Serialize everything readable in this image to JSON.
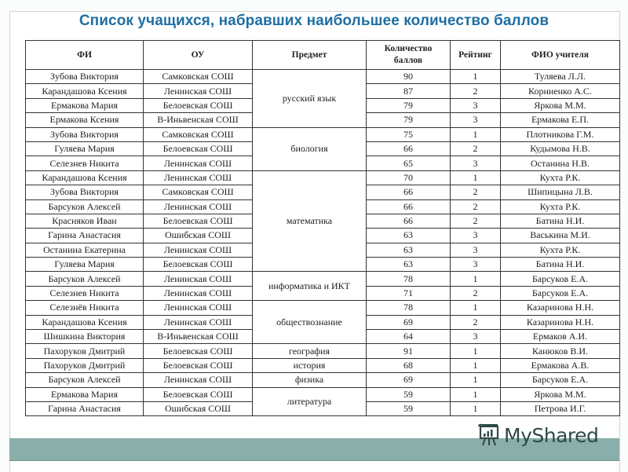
{
  "title": "Список учащихся, набравших наибольшее количество баллов",
  "table": {
    "headers": [
      "ФИ",
      "ОУ",
      "Предмет",
      "Количество баллов",
      "Рейтинг",
      "ФИО учителя"
    ],
    "header_kol_line1": "Количество",
    "header_kol_line2": "баллов",
    "rows": [
      {
        "fi": "Зубова Виктория",
        "ou": "Самковская СОШ",
        "subject": "русский язык",
        "score": "90",
        "rank": "1",
        "teacher": "Туляева Л.Л."
      },
      {
        "fi": "Карандашова Ксения",
        "ou": "Ленинская СОШ",
        "subject": "русский язык",
        "score": "87",
        "rank": "2",
        "teacher": "Корниенко А.С."
      },
      {
        "fi": "Ермакова Мария",
        "ou": "Белоевская СОШ",
        "subject": "русский язык",
        "score": "79",
        "rank": "3",
        "teacher": "Яркова М.М."
      },
      {
        "fi": "Ермакова Ксения",
        "ou": "В-Иньвенская СОШ",
        "subject": "русский язык",
        "score": "79",
        "rank": "3",
        "teacher": "Ермакова Е.П."
      },
      {
        "fi": "Зубова Виктория",
        "ou": "Самковская СОШ",
        "subject": "биология",
        "score": "75",
        "rank": "1",
        "teacher": "Плотникова Г.М."
      },
      {
        "fi": "Гуляева  Мария",
        "ou": "Белоевская СОШ",
        "subject": "биология",
        "score": "66",
        "rank": "2",
        "teacher": "Кудымова Н.В."
      },
      {
        "fi": "Селезнев Никита",
        "ou": "Ленинская СОШ",
        "subject": "биология",
        "score": "65",
        "rank": "3",
        "teacher": "Останина Н.В."
      },
      {
        "fi": "Карандашова Ксения",
        "ou": "Ленинская СОШ",
        "subject": "математика",
        "score": "70",
        "rank": "1",
        "teacher": "Кухта Р.К."
      },
      {
        "fi": "Зубова Виктория",
        "ou": "Самковская СОШ",
        "subject": "математика",
        "score": "66",
        "rank": "2",
        "teacher": "Шипицына Л.В."
      },
      {
        "fi": "Барсуков Алексей",
        "ou": "Ленинская СОШ",
        "subject": "математика",
        "score": "66",
        "rank": "2",
        "teacher": "Кухта Р.К."
      },
      {
        "fi": "Красняков Иван",
        "ou": "Белоевская СОШ",
        "subject": "математика",
        "score": "66",
        "rank": "2",
        "teacher": "Батина Н.И."
      },
      {
        "fi": "Гарина Анастасия",
        "ou": "Ошибская СОШ",
        "subject": "математика",
        "score": "63",
        "rank": "3",
        "teacher": "Васькина М.И."
      },
      {
        "fi": "Останина Екатерина",
        "ou": "Ленинская СОШ",
        "subject": "математика",
        "score": "63",
        "rank": "3",
        "teacher": "Кухта Р.К."
      },
      {
        "fi": "Гуляева  Мария",
        "ou": "Белоевская СОШ",
        "subject": "математика",
        "score": "63",
        "rank": "3",
        "teacher": "Батина Н.И."
      },
      {
        "fi": "Барсуков Алексей",
        "ou": "Ленинская СОШ",
        "subject": "информатика и ИКТ",
        "score": "78",
        "rank": "1",
        "teacher": "Барсуков Е.А."
      },
      {
        "fi": "Селезнев Никита",
        "ou": "Ленинская СОШ",
        "subject": "информатика и ИКТ",
        "score": "71",
        "rank": "2",
        "teacher": "Барсуков Е.А."
      },
      {
        "fi": "Селезнёв Никита",
        "ou": "Ленинская СОШ",
        "subject": "обществознание",
        "score": "78",
        "rank": "1",
        "teacher": "Казаринова Н.Н."
      },
      {
        "fi": "Карандашова Ксения",
        "ou": "Ленинская СОШ",
        "subject": "обществознание",
        "score": "69",
        "rank": "2",
        "teacher": "Казаринова Н.Н."
      },
      {
        "fi": "Шишкина Виктория",
        "ou": "В-Иньвенская СОШ",
        "subject": "обществознание",
        "score": "64",
        "rank": "3",
        "teacher": "Ермаков А.И."
      },
      {
        "fi": "Пахоруков Дмитрий",
        "ou": "Белоевская СОШ",
        "subject": "география",
        "score": "91",
        "rank": "1",
        "teacher": "Канюков В.И."
      },
      {
        "fi": "Пахоруков Дмитрий",
        "ou": "Белоевская СОШ",
        "subject": "история",
        "score": "68",
        "rank": "1",
        "teacher": "Ермакова А.В."
      },
      {
        "fi": "Барсуков Алексей",
        "ou": "Ленинская СОШ",
        "subject": "физика",
        "score": "69",
        "rank": "1",
        "teacher": "Барсуков Е.А."
      },
      {
        "fi": "Ермакова Мария",
        "ou": "Белоевская СОШ",
        "subject": "литература",
        "score": "59",
        "rank": "1",
        "teacher": "Яркова М.М."
      },
      {
        "fi": "Гарина Анастасия",
        "ou": "Ошибская СОШ",
        "subject": "литература",
        "score": "59",
        "rank": "1",
        "teacher": "Петрова И.Г."
      }
    ]
  },
  "watermark": {
    "text": "MyShared",
    "icon": "presentation-board-icon"
  },
  "colors": {
    "title": "#1f6fa3",
    "band": "#8aaeaa",
    "logo": "#2f4a46"
  }
}
